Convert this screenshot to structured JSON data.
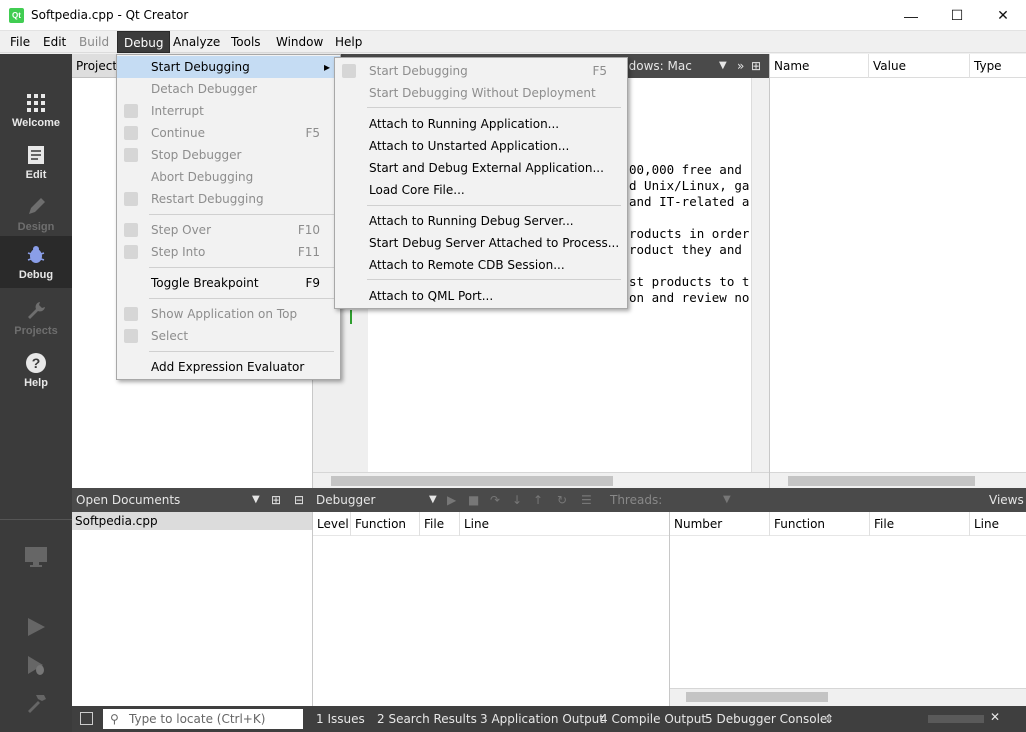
{
  "window": {
    "title": "Softpedia.cpp - Qt Creator",
    "app_icon": "Qt",
    "min": "—",
    "max": "☐",
    "close": "✕"
  },
  "menubar": [
    "File",
    "Edit",
    "Build",
    "Debug",
    "Analyze",
    "Tools",
    "Window",
    "Help"
  ],
  "modes": [
    {
      "label": "Welcome",
      "icon": "grid-icon"
    },
    {
      "label": "Edit",
      "icon": "document-icon"
    },
    {
      "label": "Design",
      "icon": "pencil-icon"
    },
    {
      "label": "Debug",
      "icon": "bug-icon"
    },
    {
      "label": "Projects",
      "icon": "wrench-icon"
    },
    {
      "label": "Help",
      "icon": "help-icon"
    }
  ],
  "projects_header": "Projects",
  "editor_tab": "ndows: Mac",
  "code_lines": [
    "00,000 free and",
    "d Unix/Linux, ga",
    "and IT-related a",
    "",
    "roducts in order",
    "roduct they and",
    "",
    "st products to t",
    "on and review no"
  ],
  "locals_columns": [
    "Name",
    "Value",
    "Type"
  ],
  "open_documents": {
    "header": "Open Documents",
    "items": [
      "Softpedia.cpp"
    ]
  },
  "debugger": {
    "label": "Debugger",
    "threads": "Threads:",
    "views": "Views"
  },
  "stack_columns": [
    "Level",
    "Function",
    "File",
    "Line"
  ],
  "breakpoint_columns": [
    "Number",
    "Function",
    "File",
    "Line"
  ],
  "debug_menu": [
    {
      "label": "Start Debugging",
      "shortcut": "",
      "disabled": false,
      "highlight": true,
      "submenu": true
    },
    {
      "label": "Detach Debugger",
      "shortcut": "",
      "disabled": true
    },
    {
      "label": "Interrupt",
      "shortcut": "",
      "disabled": true
    },
    {
      "label": "Continue",
      "shortcut": "F5",
      "disabled": true
    },
    {
      "label": "Stop Debugger",
      "shortcut": "",
      "disabled": true
    },
    {
      "label": "Abort Debugging",
      "shortcut": "",
      "disabled": true
    },
    {
      "label": "Restart Debugging",
      "shortcut": "",
      "disabled": true
    },
    {
      "label": "Step Over",
      "shortcut": "F10",
      "disabled": true
    },
    {
      "label": "Step Into",
      "shortcut": "F11",
      "disabled": true
    },
    {
      "label": "Toggle Breakpoint",
      "shortcut": "F9",
      "disabled": false
    },
    {
      "label": "Show Application on Top",
      "shortcut": "",
      "disabled": true
    },
    {
      "label": "Select",
      "shortcut": "",
      "disabled": true
    },
    {
      "label": "Add Expression Evaluator",
      "shortcut": "",
      "disabled": false
    }
  ],
  "start_submenu": [
    {
      "label": "Start Debugging",
      "shortcut": "F5",
      "disabled": true
    },
    {
      "label": "Start Debugging Without Deployment",
      "shortcut": "",
      "disabled": true
    },
    {
      "label": "Attach to Running Application...",
      "disabled": false
    },
    {
      "label": "Attach to Unstarted Application...",
      "disabled": false
    },
    {
      "label": "Start and Debug External Application...",
      "disabled": false
    },
    {
      "label": "Load Core File...",
      "disabled": false
    },
    {
      "label": "Attach to Running Debug Server...",
      "disabled": false
    },
    {
      "label": "Start Debug Server Attached to Process...",
      "disabled": false
    },
    {
      "label": "Attach to Remote CDB Session...",
      "disabled": false
    },
    {
      "label": "Attach to QML Port...",
      "disabled": false
    }
  ],
  "statusbar": {
    "locate_placeholder": "Type to locate (Ctrl+K)",
    "tabs": [
      "1  Issues",
      "2  Search Results",
      "3  Application Output",
      "4  Compile Output",
      "5  Debugger Console"
    ]
  },
  "colors": {
    "accent_highlight": "#c5dcf3",
    "sidebar": "#3b3b3b",
    "active_menu": "#3c3c3c"
  }
}
